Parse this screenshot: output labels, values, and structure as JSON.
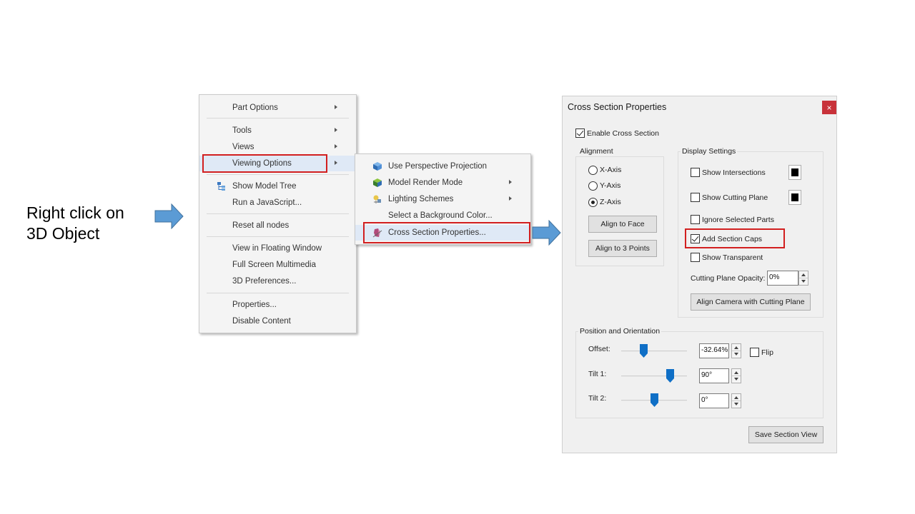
{
  "caption": {
    "line1": "Right click on",
    "line2": "3D Object"
  },
  "context_menu": {
    "items": [
      {
        "label": "Part Options",
        "has_submenu": true
      },
      {
        "label": "Tools",
        "has_submenu": true
      },
      {
        "label": "Views",
        "has_submenu": true
      },
      {
        "label": "Viewing Options",
        "has_submenu": true,
        "highlighted": true
      },
      {
        "label": "Show Model Tree",
        "icon": "model-tree-icon"
      },
      {
        "label": "Run a JavaScript..."
      },
      {
        "label": "Reset all nodes"
      },
      {
        "label": "View in Floating Window"
      },
      {
        "label": "Full Screen Multimedia"
      },
      {
        "label": "3D Preferences..."
      },
      {
        "label": "Properties..."
      },
      {
        "label": "Disable Content"
      }
    ]
  },
  "submenu": {
    "items": [
      {
        "label": "Use Perspective Projection",
        "icon": "perspective-cube-icon"
      },
      {
        "label": "Model Render Mode",
        "icon": "render-mode-icon",
        "has_submenu": true
      },
      {
        "label": "Lighting Schemes",
        "icon": "lighting-icon",
        "has_submenu": true
      },
      {
        "label": "Select a Background Color..."
      },
      {
        "label": "Cross Section Properties...",
        "icon": "cross-section-icon",
        "highlighted": true
      }
    ]
  },
  "dialog": {
    "title": "Cross Section Properties",
    "close_label": "×",
    "enable_cross_section": {
      "label": "Enable Cross Section",
      "checked": true
    },
    "alignment": {
      "title": "Alignment",
      "options": [
        {
          "label": "X-Axis",
          "selected": false
        },
        {
          "label": "Y-Axis",
          "selected": false
        },
        {
          "label": "Z-Axis",
          "selected": true
        }
      ],
      "align_face_label": "Align to Face",
      "align_points_label": "Align to 3 Points"
    },
    "display": {
      "title": "Display Settings",
      "show_intersections": {
        "label": "Show Intersections",
        "checked": false
      },
      "show_cutting_plane": {
        "label": "Show Cutting Plane",
        "checked": false
      },
      "ignore_selected_parts": {
        "label": "Ignore Selected Parts",
        "checked": false
      },
      "add_section_caps": {
        "label": "Add Section Caps",
        "checked": true
      },
      "show_transparent": {
        "label": "Show Transparent",
        "checked": false
      },
      "opacity_label": "Cutting Plane Opacity:",
      "opacity_value": "0%",
      "align_camera_label": "Align Camera with Cutting Plane"
    },
    "position": {
      "title": "Position and Orientation",
      "offset": {
        "label": "Offset:",
        "value": "-32.64%",
        "slider_fraction": 0.34
      },
      "flip_label": "Flip",
      "tilt1": {
        "label": "Tilt 1:",
        "value": "90°",
        "slider_fraction": 0.74
      },
      "tilt2": {
        "label": "Tilt 2:",
        "value": "0°",
        "slider_fraction": 0.5
      }
    },
    "save_label": "Save Section View"
  },
  "colors": {
    "arrow": "#5b9bd5",
    "highlight_box": "#d21f1f",
    "close_button": "#c8323a",
    "slider_thumb": "#0f6fc6"
  }
}
